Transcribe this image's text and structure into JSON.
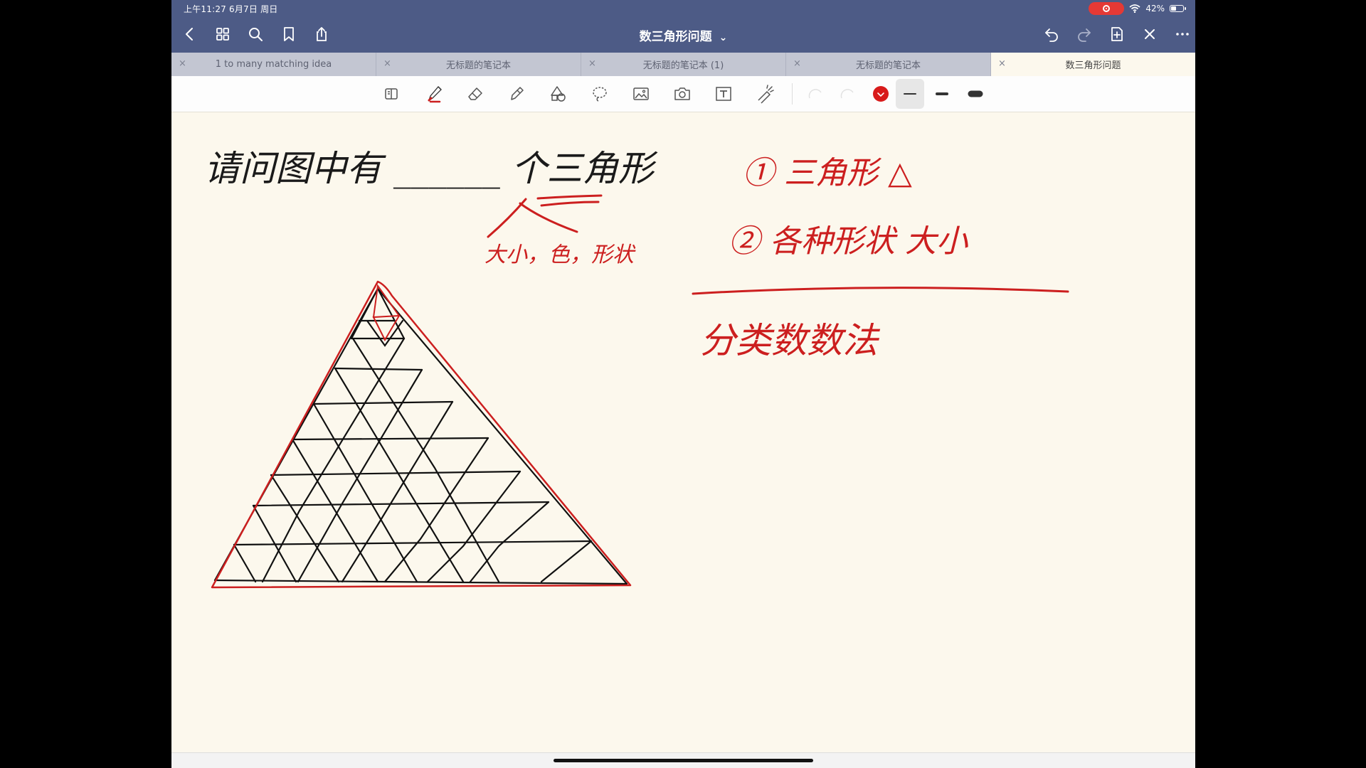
{
  "status": {
    "time_date": "上午11:27   6月7日 周日",
    "battery": "42%"
  },
  "nav": {
    "title": "数三角形问题",
    "title_chevron": "⌄"
  },
  "tabs": [
    {
      "label": "1 to many matching idea",
      "close": "×"
    },
    {
      "label": "无标题的笔记本",
      "close": "×"
    },
    {
      "label": "无标题的笔记本 (1)",
      "close": "×"
    },
    {
      "label": "无标题的笔记本",
      "close": "×"
    },
    {
      "label": "数三角形问题",
      "close": "×"
    }
  ],
  "tools": {
    "pen_color": "#cc1f1f",
    "selected_color": "#d81b1b",
    "toolbar_icons": [
      "read-mode-icon",
      "pen-icon",
      "eraser-icon",
      "highlighter-icon",
      "shapes-icon",
      "lasso-icon",
      "image-icon",
      "camera-icon",
      "textbox-icon",
      "laser-pointer-icon"
    ]
  },
  "colors": {
    "topbar": "#4d5b86",
    "paper": "#fcf8ed",
    "ink_red": "#cc1f1f",
    "ink_black": "#111111"
  },
  "note": {
    "question": "请问图中有 ______ 个三角形",
    "hint": "大小，色，形状",
    "point1": "① 三角形 △",
    "point2": "② 各种形状 大小",
    "method": "分类数数法"
  }
}
